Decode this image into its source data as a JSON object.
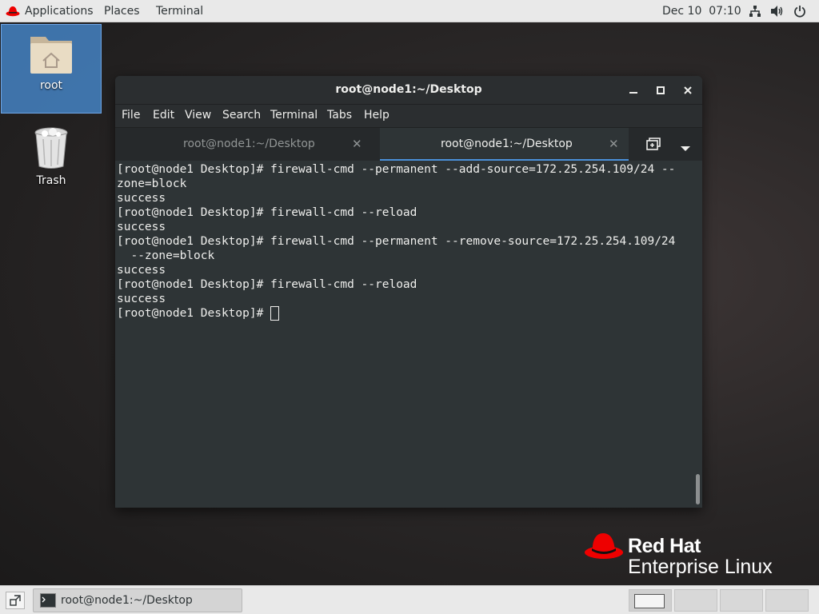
{
  "topbar": {
    "applications": "Applications",
    "places": "Places",
    "terminal": "Terminal",
    "clock": "Dec 10  07:10",
    "icons": [
      "redhat-logo-icon",
      "network-icon",
      "volume-icon",
      "power-icon"
    ]
  },
  "desktop": {
    "icons": [
      {
        "label": "root",
        "icon": "home-folder-icon",
        "selected": true
      },
      {
        "label": "Trash",
        "icon": "trash-icon",
        "selected": false
      }
    ]
  },
  "terminal_window": {
    "title": "root@node1:~/Desktop",
    "menu": [
      "File",
      "Edit",
      "View",
      "Search",
      "Terminal",
      "Tabs",
      "Help"
    ],
    "tabs": [
      {
        "label": "root@node1:~/Desktop",
        "active": false
      },
      {
        "label": "root@node1:~/Desktop",
        "active": true
      }
    ],
    "lines": [
      "[root@node1 Desktop]# firewall-cmd --permanent --add-source=172.25.254.109/24 --",
      "zone=block",
      "success",
      "[root@node1 Desktop]# firewall-cmd --reload",
      "success",
      "[root@node1 Desktop]# firewall-cmd --permanent --remove-source=172.25.254.109/24",
      "  --zone=block",
      "success",
      "[root@node1 Desktop]# firewall-cmd --reload",
      "success"
    ],
    "prompt": "[root@node1 Desktop]# "
  },
  "brand": {
    "line1": "Red Hat",
    "line2": "Enterprise Linux",
    "accent": "#ee0000"
  },
  "taskbar": {
    "window_label": "root@node1:~/Desktop",
    "workspaces": 4,
    "active_workspace": 1
  }
}
